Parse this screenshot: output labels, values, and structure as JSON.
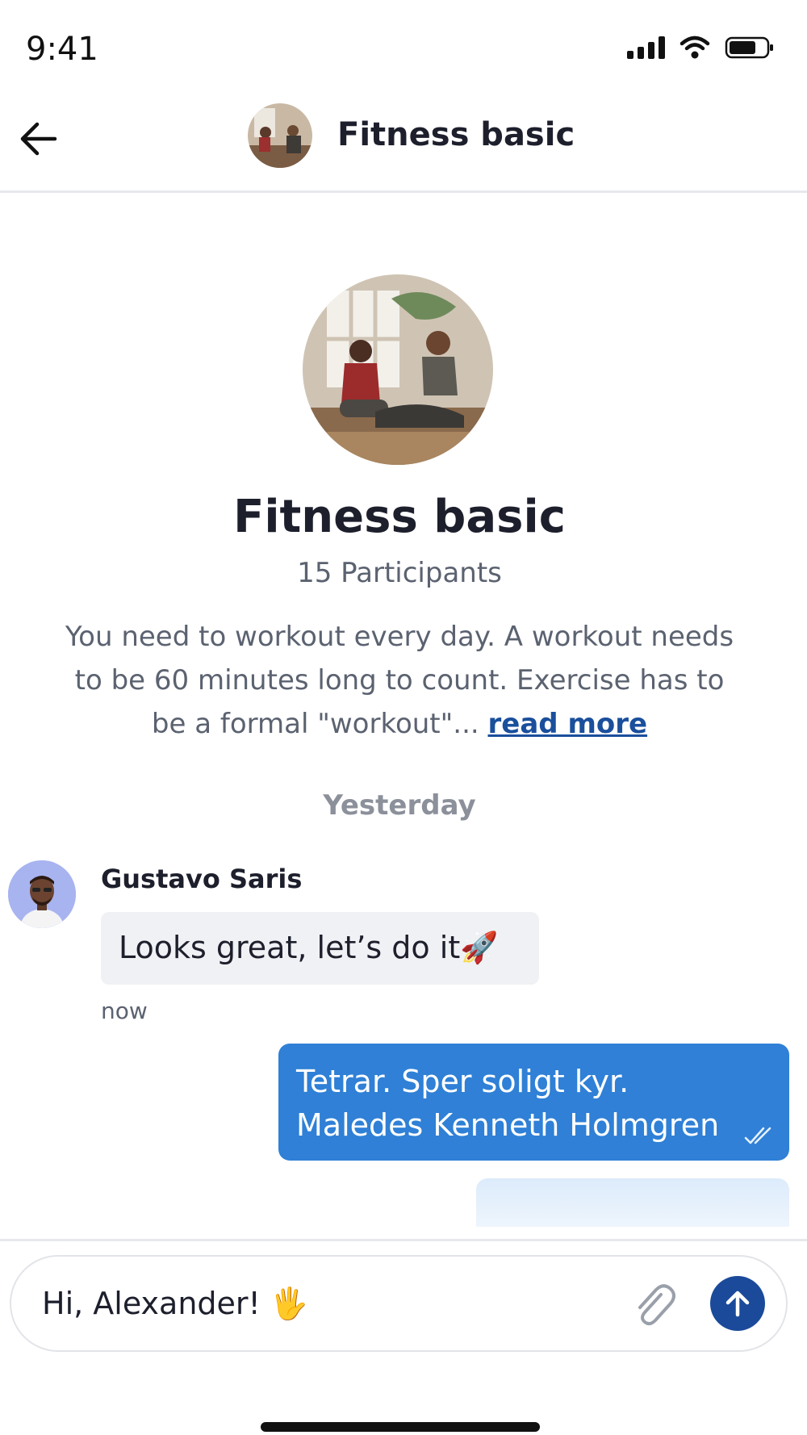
{
  "status_bar": {
    "time": "9:41",
    "icons": [
      "signal-icon",
      "wifi-icon",
      "battery-icon"
    ]
  },
  "header": {
    "title": "Fitness basic",
    "back_icon": "arrow-left-icon"
  },
  "group": {
    "title": "Fitness basic",
    "participants": "15 Participants",
    "description": "You need to workout every day. A workout needs to be 60 minutes long to count. Exercise has to be a formal \"workout\"...",
    "read_more": "read more"
  },
  "chat": {
    "day_label": "Yesterday",
    "messages": [
      {
        "sender": "Gustavo Saris",
        "text": "Looks great, let’s do it🚀",
        "time": "now"
      },
      {
        "line1": "Tetrar. Sper soligt kyr.",
        "line2": "Maledes Kenneth Holmgren"
      }
    ]
  },
  "composer": {
    "value": "Hi, Alexander! 🖐",
    "attach_icon": "paperclip-icon",
    "send_icon": "arrow-up-icon"
  },
  "colors": {
    "accent": "#2f80d6",
    "send_button": "#1b4a9a",
    "link": "#1a4f9c",
    "incoming_bubble": "#f0f1f4"
  }
}
